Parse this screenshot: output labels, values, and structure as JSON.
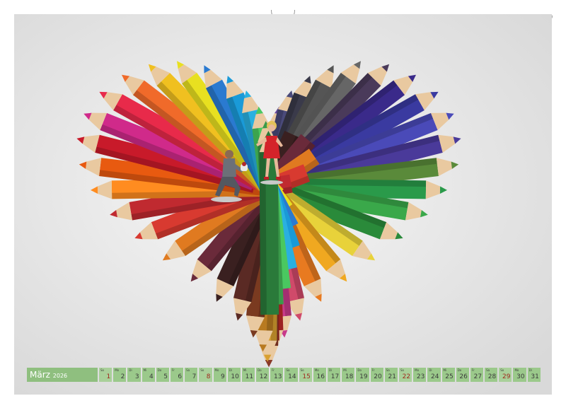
{
  "calendar": {
    "month": "März",
    "year": "2026",
    "weekday_abbr": [
      "So",
      "Mo",
      "Di",
      "Mi",
      "Do",
      "Fr",
      "Sa"
    ],
    "first_weekday_index": 0,
    "days": [
      "1",
      "2",
      "3",
      "4",
      "5",
      "6",
      "7",
      "8",
      "9",
      "10",
      "11",
      "12",
      "13",
      "14",
      "15",
      "16",
      "17",
      "18",
      "19",
      "20",
      "21",
      "22",
      "23",
      "24",
      "25",
      "26",
      "27",
      "28",
      "29",
      "30",
      "31"
    ],
    "sunday_color": "#a0281c"
  },
  "photo": {
    "subject": "heart-of-colored-pencils",
    "background_color": "#eeeeee",
    "figures": [
      "kneeling-man-figurine",
      "woman-in-red-dress-figurine"
    ]
  },
  "colors": {
    "calendar_bar": "#8fbf7f",
    "binding_holes": "#9a9a9a"
  }
}
